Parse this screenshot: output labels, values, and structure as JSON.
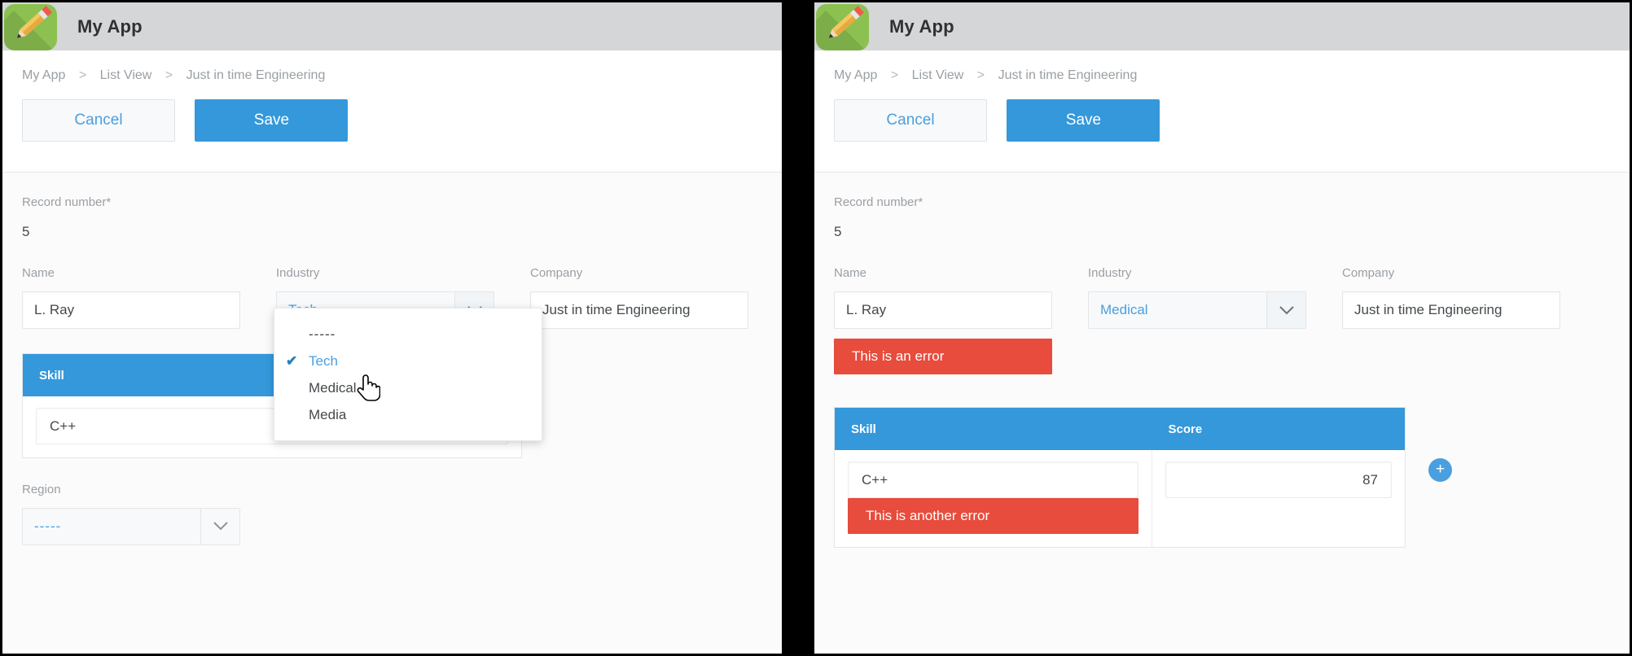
{
  "app": {
    "icon_name": "pencil-app-icon",
    "title": "My App",
    "header_bg": "#d4d6d7",
    "icon_bg": "#8cc152"
  },
  "breadcrumb": {
    "items": [
      "My App",
      "List View",
      "Just in time Engineering"
    ],
    "separator": ">"
  },
  "actions": {
    "cancel_label": "Cancel",
    "save_label": "Save",
    "save_bg": "#3498db",
    "cancel_text_color": "#4a9fe0"
  },
  "form": {
    "record_number_label": "Record number*",
    "record_number_value": "5",
    "name_label": "Name",
    "name_value": "L. Ray",
    "industry_label": "Industry",
    "company_label": "Company",
    "company_value": "Just in time Engineering",
    "region_label": "Region",
    "region_value": "-----"
  },
  "left_panel": {
    "industry_value": "Tech",
    "dropdown": {
      "open": true,
      "options": [
        "-----",
        "Tech",
        "Medical",
        "Media"
      ],
      "selected": "Tech",
      "check_glyph": "✔"
    },
    "table": {
      "columns": [
        "Skill"
      ],
      "rows": [
        {
          "skill": "C++"
        }
      ]
    }
  },
  "right_panel": {
    "industry_value": "Medical",
    "field_error": "This is an error",
    "error_bg": "#e74c3c",
    "table": {
      "columns": [
        "Skill",
        "Score"
      ],
      "rows": [
        {
          "skill": "C++",
          "score": "87",
          "error": "This is another error"
        }
      ],
      "add_button_label": "+",
      "add_button_color": "#4a9fe0"
    }
  },
  "icons": {
    "chevron_down": "chevron-down-icon",
    "hand_cursor": "hand-pointer-cursor"
  }
}
